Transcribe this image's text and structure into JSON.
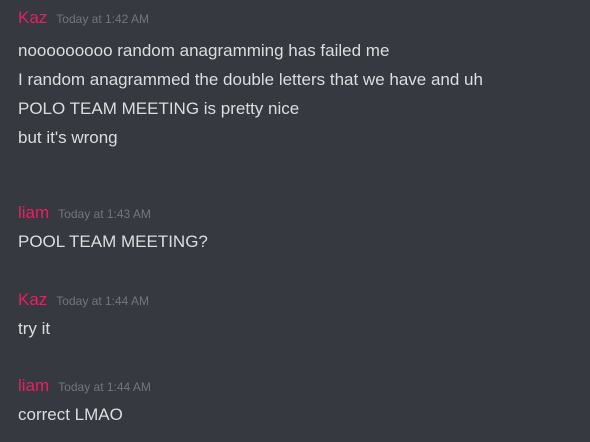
{
  "messages": [
    {
      "author": "Kaz",
      "timestamp": "Today at 1:42 AM",
      "lines": [
        "nooooooooo random anagramming has failed me",
        "I random anagrammed the double letters that we have and uh",
        "POLO TEAM MEETING is pretty nice",
        "but it's wrong"
      ]
    },
    {
      "author": "liam",
      "timestamp": "Today at 1:43 AM",
      "lines": [
        "POOL TEAM MEETING?"
      ]
    },
    {
      "author": "Kaz",
      "timestamp": "Today at 1:44 AM",
      "lines": [
        "try it"
      ]
    },
    {
      "author": "liam",
      "timestamp": "Today at 1:44 AM",
      "lines": [
        "correct LMAO"
      ]
    }
  ],
  "colors": {
    "background": "#36393f",
    "username": "#e91e63",
    "timestamp": "#72767d",
    "text": "#dcddde"
  }
}
